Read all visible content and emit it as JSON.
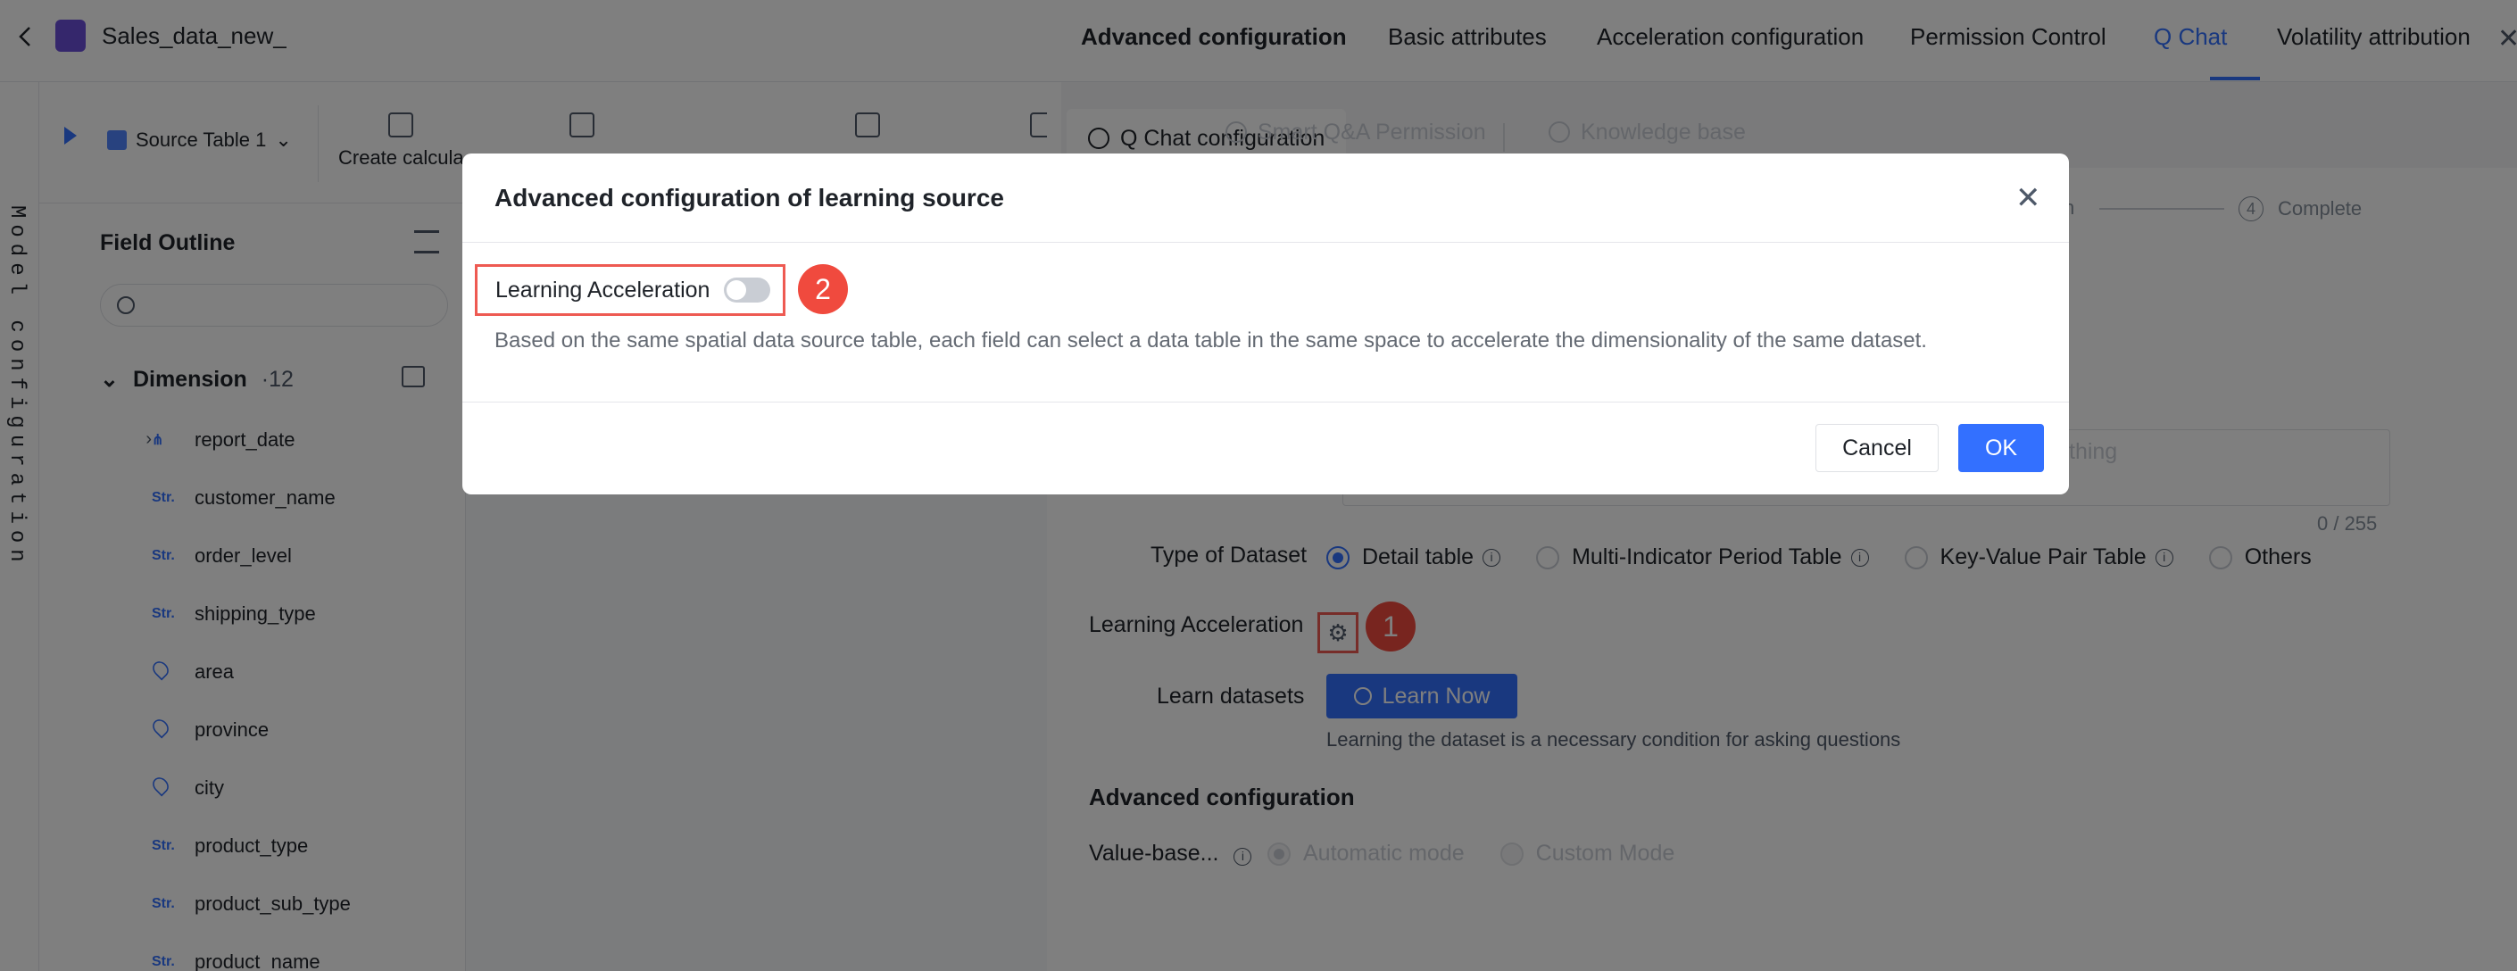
{
  "app": {
    "title": "Sales_data_new_",
    "vertical_label": "Model configuration"
  },
  "toolbar": {
    "source_table": "Source Table 1",
    "create_calc": "Create calcula"
  },
  "outline": {
    "title": "Field Outline",
    "search_placeholder": "",
    "dimension_label": "Dimension",
    "dimension_count": "·12",
    "fields": [
      {
        "type": "hier",
        "name": "report_date"
      },
      {
        "type": "Str.",
        "name": "customer_name"
      },
      {
        "type": "Str.",
        "name": "order_level"
      },
      {
        "type": "Str.",
        "name": "shipping_type"
      },
      {
        "type": "geo",
        "name": "area"
      },
      {
        "type": "geo",
        "name": "province"
      },
      {
        "type": "geo",
        "name": "city"
      },
      {
        "type": "Str.",
        "name": "product_type"
      },
      {
        "type": "Str.",
        "name": "product_sub_type"
      },
      {
        "type": "Str.",
        "name": "product_name"
      }
    ]
  },
  "drawer": {
    "tabs": {
      "advanced": "Advanced configuration",
      "basic": "Basic attributes",
      "acceleration": "Acceleration configuration",
      "permission": "Permission Control",
      "qchat": "Q Chat",
      "volatility": "Volatility attribution"
    },
    "subtabs": {
      "config": "Q Chat configuration",
      "smart_qa": "Smart Q&A Permission",
      "knowledge": "Knowledge base"
    },
    "steps": {
      "fragment": "n",
      "step4_num": "4",
      "step4_label": "Complete"
    },
    "description": {
      "placeholder_fragment": "thing",
      "count": "0 / 255"
    },
    "dataset_type": {
      "label": "Type of Dataset",
      "options": [
        "Detail table",
        "Multi-Indicator Period Table",
        "Key-Value Pair Table",
        "Others"
      ],
      "selected": "Detail table"
    },
    "learning_acceleration": {
      "label": "Learning Acceleration",
      "marker": "1"
    },
    "learn": {
      "label": "Learn datasets",
      "button": "Learn Now",
      "hint": "Learning the dataset is a necessary condition for asking questions"
    },
    "advanced_section": {
      "title": "Advanced configuration",
      "value_based_label": "Value-base...",
      "modes": [
        "Automatic mode",
        "Custom Mode"
      ],
      "selected": "Automatic mode"
    }
  },
  "modal": {
    "title": "Advanced configuration of learning source",
    "toggle_label": "Learning Acceleration",
    "toggle_on": false,
    "marker": "2",
    "description": "Based on the same spatial data source table, each field can select a data table in the same space to accelerate the dimensionality of the same dataset.",
    "cancel": "Cancel",
    "ok": "OK"
  },
  "colors": {
    "accent": "#3370ff",
    "marker": "#f04a3e",
    "highlight_border": "#ee5a52"
  }
}
